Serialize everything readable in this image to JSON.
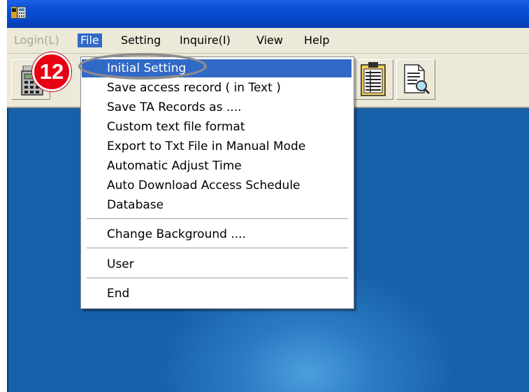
{
  "menubar": {
    "items": [
      {
        "label": "Login(L)",
        "state": "disabled"
      },
      {
        "label": "File",
        "state": "active"
      },
      {
        "label": "Setting",
        "state": "normal"
      },
      {
        "label": "Inquire(I)",
        "state": "normal"
      },
      {
        "label": "View",
        "state": "normal"
      },
      {
        "label": "Help",
        "state": "normal"
      }
    ]
  },
  "toolbar": {
    "buttons": [
      {
        "icon": "calculator-icon"
      },
      {
        "icon": "clipboard-list-icon"
      },
      {
        "icon": "document-search-icon"
      }
    ]
  },
  "file_menu": {
    "items": [
      {
        "label": "Initial Setting",
        "highlighted": true
      },
      {
        "label": "Save access record ( in Text )"
      },
      {
        "label": "Save TA Records as ...."
      },
      {
        "label": "Custom text file format"
      },
      {
        "label": "Export to Txt File in Manual Mode"
      },
      {
        "label": "Automatic Adjust Time"
      },
      {
        "label": "Auto Download Access Schedule"
      },
      {
        "label": "Database"
      },
      {
        "label": "Change Background ...."
      },
      {
        "label": "User"
      },
      {
        "label": "End"
      }
    ]
  },
  "annotation": {
    "step_number": "12",
    "badge_color": "#e60012",
    "outline_color": "#8c8c8c"
  },
  "colors": {
    "titlebar": "#0a4ed6",
    "menu_highlight": "#3169c6",
    "client_background": "#175fa8"
  }
}
